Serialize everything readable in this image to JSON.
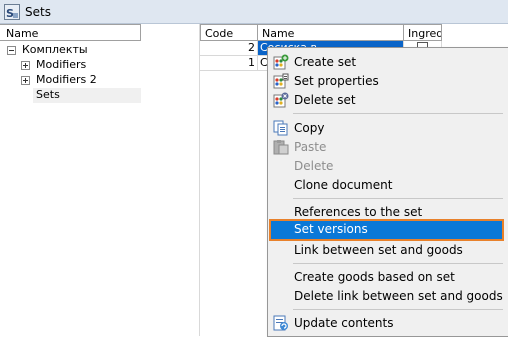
{
  "window": {
    "title": "Sets",
    "icon": "sets-app-icon"
  },
  "tree": {
    "header": "Name",
    "items": [
      {
        "label": "Комплекты",
        "expander": "minus"
      },
      {
        "label": "Modifiers",
        "expander": "plus"
      },
      {
        "label": "Modifiers 2",
        "expander": "plus"
      },
      {
        "label": "Sets",
        "expander": "none",
        "selected": true
      }
    ]
  },
  "grid": {
    "columns": [
      "Code",
      "Name",
      "Ingredi"
    ],
    "rows": [
      {
        "code": "2",
        "name": "Сосиска в",
        "ingredient_checked": false
      },
      {
        "code": "1",
        "name": "С",
        "ingredient_checked": false
      }
    ]
  },
  "context_menu": {
    "items": [
      {
        "label": "Create set",
        "icon": "create-set-icon",
        "enabled": true
      },
      {
        "label": "Set properties",
        "icon": "set-properties-icon",
        "enabled": true
      },
      {
        "label": "Delete set",
        "icon": "delete-set-icon",
        "enabled": true
      },
      {
        "label": "Copy",
        "icon": "copy-icon",
        "enabled": true
      },
      {
        "label": "Paste",
        "icon": "paste-icon",
        "enabled": false
      },
      {
        "label": "Delete",
        "icon": "",
        "enabled": false
      },
      {
        "label": "Clone document",
        "icon": "",
        "enabled": true
      },
      {
        "label": "References to the set",
        "icon": "",
        "enabled": true
      },
      {
        "label": "Set versions",
        "icon": "",
        "enabled": true,
        "highlighted": true
      },
      {
        "label": "Link between set and goods",
        "icon": "",
        "enabled": true
      },
      {
        "label": "Create goods based on set",
        "icon": "",
        "enabled": true
      },
      {
        "label": "Delete link between set and goods",
        "icon": "",
        "enabled": true
      },
      {
        "label": "Update contents",
        "icon": "update-contents-icon",
        "enabled": true
      }
    ]
  },
  "colors": {
    "selection": "#0a64c8",
    "menu_highlight": "#0a78d7",
    "highlight_border": "#e8812b"
  }
}
